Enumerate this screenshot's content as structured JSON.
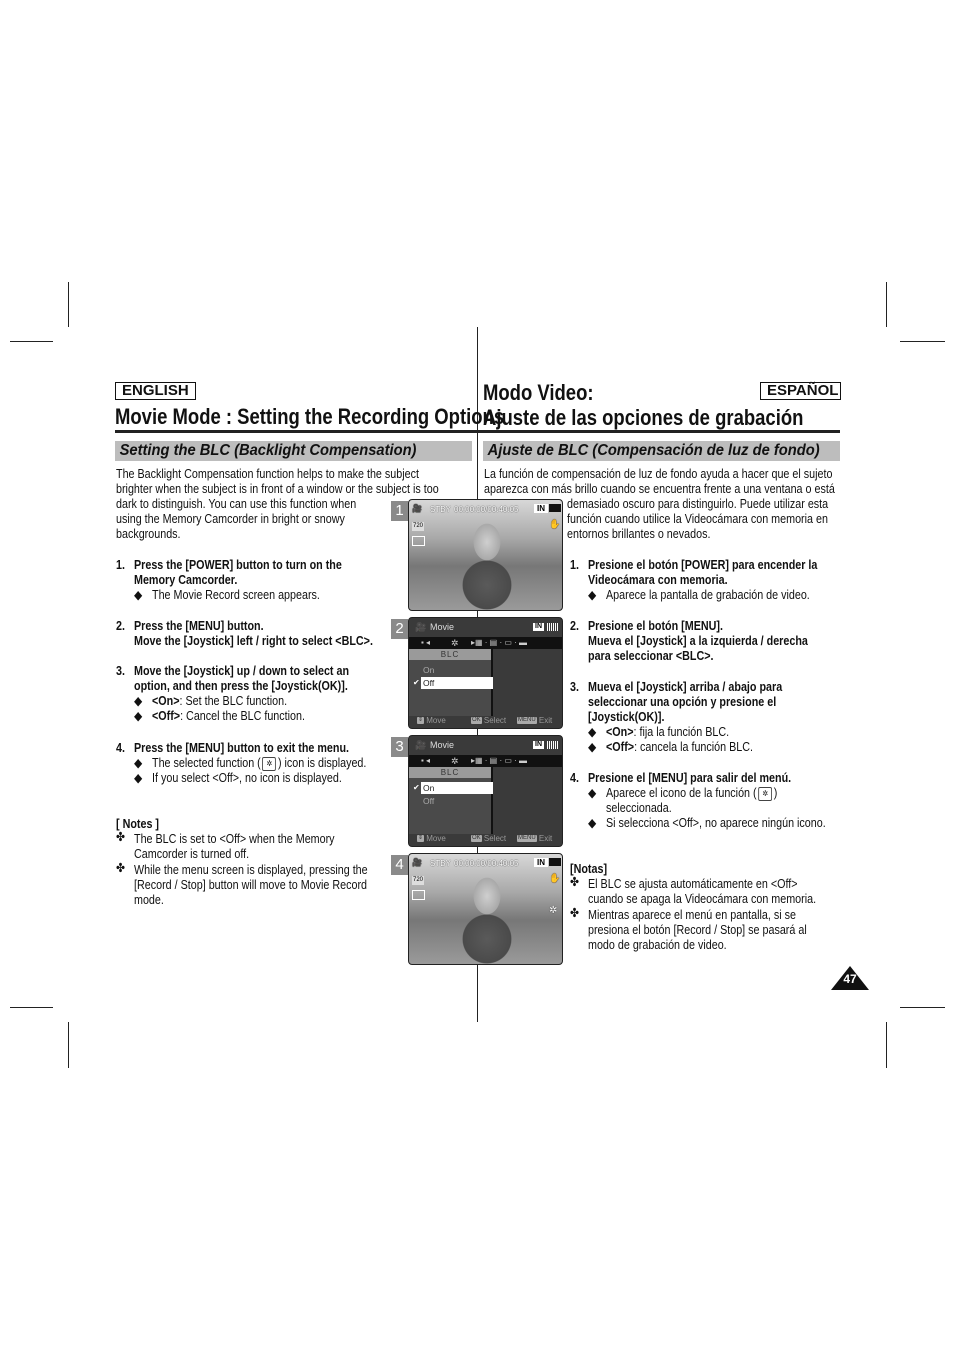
{
  "english": {
    "lang_label": "ENGLISH",
    "title": "Movie Mode : Setting the Recording Options",
    "section": "Setting the BLC (Backlight Compensation)",
    "intro": [
      "The Backlight Compensation function helps to make the subject",
      "brighter when the subject is in front of a window or the subject is too",
      "dark to distinguish. You can use this function when",
      "using the Memory Camcorder in bright or snowy",
      "backgrounds."
    ],
    "steps": [
      {
        "num": "1.",
        "lines": [
          "Press the [POWER] button to turn on the",
          "Memory Camcorder."
        ],
        "bullets": [
          "The Movie Record screen appears."
        ]
      },
      {
        "num": "2.",
        "lines": [
          "Press the [MENU] button.",
          "Move the [Joystick] left / right to select <BLC>."
        ]
      },
      {
        "num": "3.",
        "lines": [
          "Move the [Joystick] up / down to select an",
          "option, and then press the [Joystick(OK)]."
        ],
        "bullets": [
          {
            "b": "<On>",
            "t": ": Set the BLC function."
          },
          {
            "b": "<Off>",
            "t": ": Cancel the BLC function."
          }
        ]
      },
      {
        "num": "4.",
        "lines": [
          "Press the [MENU] button to exit the menu."
        ],
        "bullets": [
          {
            "pre": "The selected function (",
            "post": ") icon is displayed."
          },
          "If you select <Off>, no icon is displayed."
        ]
      }
    ],
    "notes_title": "[ Notes ]",
    "notes": [
      [
        "The BLC is set to <Off> when the Memory",
        "Camcorder is turned off."
      ],
      [
        "While the menu screen is displayed, pressing the",
        "[Record / Stop] button will move to Movie Record",
        "mode."
      ]
    ]
  },
  "spanish": {
    "lang_label": "ESPAÑOL",
    "title_line1": "Modo Video:",
    "title_line2": "Ajuste de las opciones de grabación",
    "section": "Ajuste de BLC (Compensación de luz de fondo)",
    "intro": [
      "La función de compensación de luz de fondo ayuda a hacer que el sujeto",
      "aparezca con más brillo cuando se encuentra frente a una ventana o está",
      "demasiado oscuro para distinguirlo. Puede utilizar esta",
      "función cuando utilice la Videocámara con memoria en",
      "entornos brillantes o nevados."
    ],
    "steps": [
      {
        "num": "1.",
        "lines": [
          "Presione el botón [POWER] para encender la",
          "Videocámara con memoria."
        ],
        "bullets": [
          "Aparece la pantalla de grabación de video."
        ]
      },
      {
        "num": "2.",
        "lines": [
          "Presione el botón [MENU].",
          "Mueva el [Joystick] a la izquierda / derecha",
          "para seleccionar <BLC>."
        ]
      },
      {
        "num": "3.",
        "lines": [
          "Mueva el [Joystick] arriba / abajo para",
          "seleccionar una opción y presione el",
          "[Joystick(OK)]."
        ],
        "bullets": [
          {
            "b": "<On>",
            "t": ": fija la función BLC."
          },
          {
            "b": "<Off>",
            "t": ": cancela la función BLC."
          }
        ]
      },
      {
        "num": "4.",
        "lines": [
          "Presione el [MENU] para salir del menú."
        ],
        "bullets": [
          {
            "pre": "Aparece el icono de la función (",
            "post": ")",
            "cont": "seleccionada."
          },
          "Si selecciona <Off>, no aparece ningún icono."
        ]
      }
    ],
    "notes_title": "[Notas]",
    "notes": [
      [
        "El BLC se ajusta automáticamente en <Off>",
        "cuando se apaga la Videocámara con memoria."
      ],
      [
        "Mientras aparece el menú en pantalla, si se",
        "presiona el botón [Record / Stop] se pasará al",
        "modo de grabación de video."
      ]
    ]
  },
  "bullet_glyph": "◆",
  "note_glyph": "✤",
  "blc_icon_glyph": "✲",
  "screens": {
    "record": {
      "status": "STBY",
      "time": "00:00:00/00:40:05",
      "mem": "IN",
      "quality": "720",
      "blc_icon": "✲"
    },
    "menu": {
      "mode": "Movie",
      "mem": "IN",
      "label": "BLC",
      "options": [
        "On",
        "Off"
      ],
      "check": "✔",
      "footer_move": "Move",
      "footer_select": "Select",
      "footer_exit": "Exit",
      "key_ok": "OK",
      "key_menu": "MENU"
    },
    "step_numbers": [
      "1",
      "2",
      "3",
      "4"
    ],
    "menu_selected": [
      "Off",
      "On"
    ]
  },
  "page_number": "47"
}
